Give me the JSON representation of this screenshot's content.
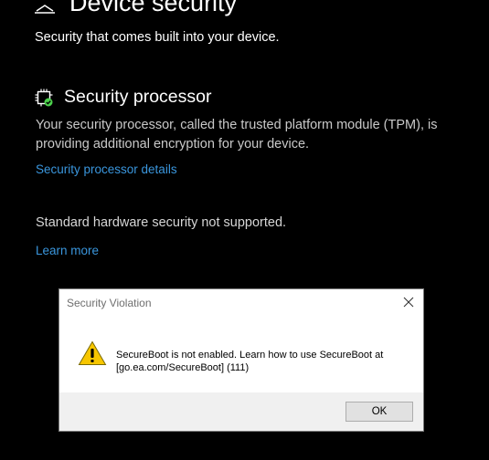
{
  "header": {
    "title": "Device security",
    "icon": "laptop-shield-icon",
    "subtitle": "Security that comes built into your device."
  },
  "security_processor": {
    "icon": "chip-check-icon",
    "title": "Security processor",
    "description": "Your security processor, called the trusted platform module (TPM), is providing additional encryption for your device.",
    "details_link": "Security processor details"
  },
  "hardware_status": {
    "text": "Standard hardware security not supported.",
    "learn_more_link": "Learn more"
  },
  "dialog": {
    "title": "Security Violation",
    "icon": "warning-icon",
    "message": "SecureBoot is not enabled. Learn how to use SecureBoot at [go.ea.com/SecureBoot] (111)",
    "ok_label": "OK"
  },
  "colors": {
    "background": "#000000",
    "link": "#3a96dd",
    "check_green": "#4cd14c",
    "warning_yellow": "#f7c600"
  }
}
